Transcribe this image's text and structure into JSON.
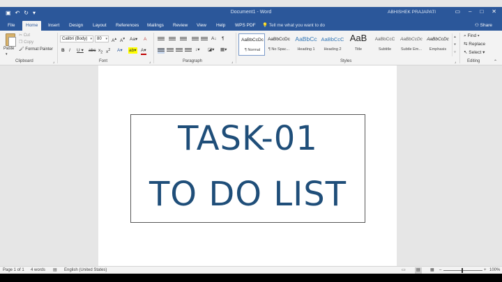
{
  "window": {
    "title": "Document1 - Word",
    "user": "ABHISHEK PRAJAPATI"
  },
  "tabs": [
    {
      "label": "File"
    },
    {
      "label": "Home"
    },
    {
      "label": "Insert"
    },
    {
      "label": "Design"
    },
    {
      "label": "Layout"
    },
    {
      "label": "References"
    },
    {
      "label": "Mailings"
    },
    {
      "label": "Review"
    },
    {
      "label": "View"
    },
    {
      "label": "Help"
    },
    {
      "label": "WPS PDF"
    }
  ],
  "tell_me": "Tell me what you want to do",
  "share": "Share",
  "clipboard": {
    "paste": "Paste",
    "cut": "Cut",
    "copy": "Copy",
    "format_painter": "Format Painter",
    "label": "Clipboard"
  },
  "font": {
    "name": "Calibri (Body)",
    "size": "80",
    "label": "Font"
  },
  "paragraph": {
    "label": "Paragraph"
  },
  "styles": {
    "label": "Styles",
    "items": [
      {
        "preview": "AaBbCcDc",
        "name": "¶ Normal"
      },
      {
        "preview": "AaBbCcDc",
        "name": "¶ No Spac..."
      },
      {
        "preview": "AaBbCc",
        "name": "Heading 1"
      },
      {
        "preview": "AaBbCcC",
        "name": "Heading 2"
      },
      {
        "preview": "AaB",
        "name": "Title"
      },
      {
        "preview": "AaBbCcC",
        "name": "Subtitle"
      },
      {
        "preview": "AaBbCcDc",
        "name": "Subtle Em..."
      },
      {
        "preview": "AaBbCcDc",
        "name": "Emphasis"
      }
    ]
  },
  "editing": {
    "find": "Find",
    "replace": "Replace",
    "select": "Select",
    "label": "Editing"
  },
  "document": {
    "line1": "TASK-01",
    "line2": "TO DO LIST"
  },
  "status": {
    "page": "Page 1 of 1",
    "words": "4 words",
    "language": "English (United States)",
    "zoom": "100%"
  }
}
